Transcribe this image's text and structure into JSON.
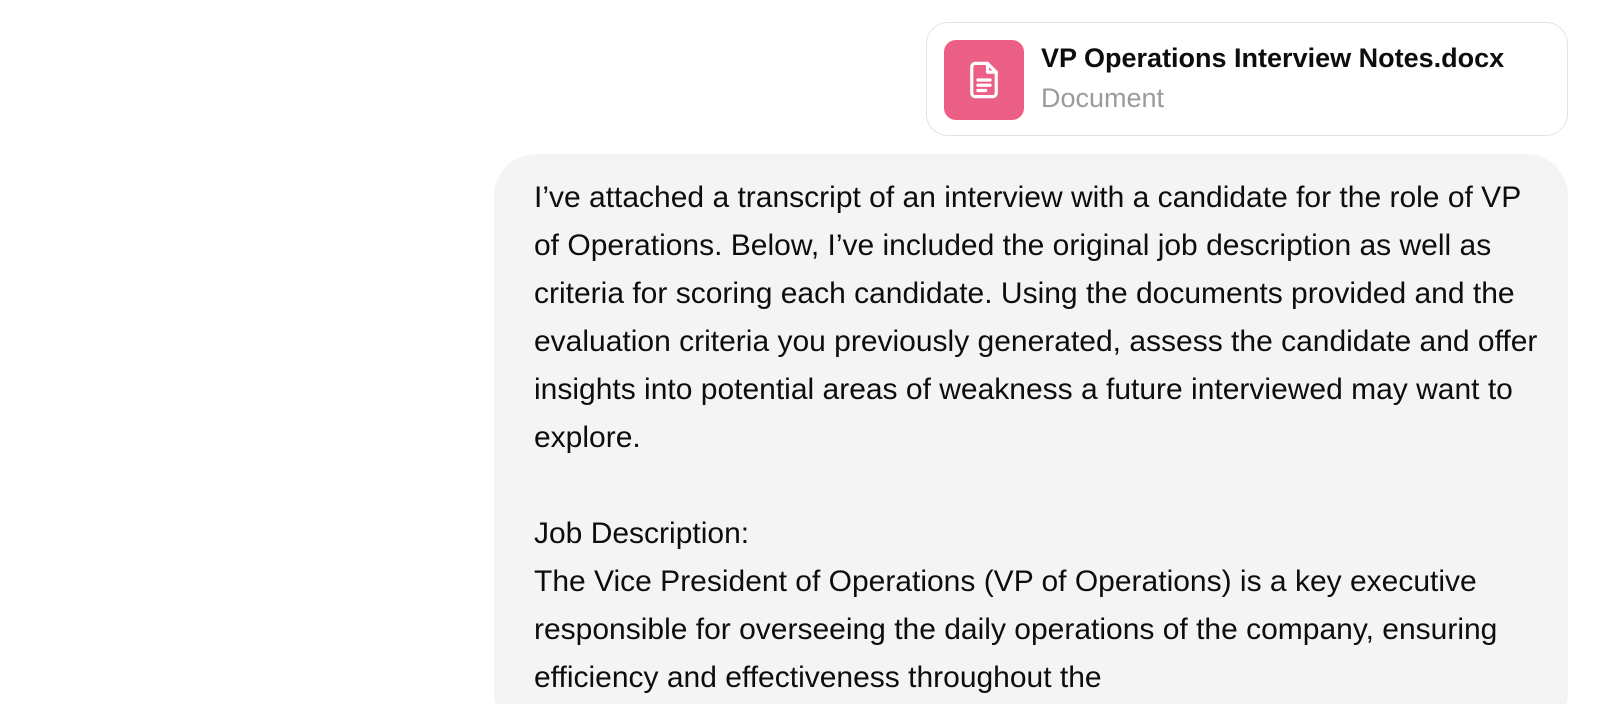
{
  "attachment": {
    "file_name": "VP Operations Interview Notes.docx",
    "file_type": "Document",
    "icon": "document-icon",
    "icon_bg_color": "#ec5f87"
  },
  "message": {
    "intro": "I’ve attached a transcript of an interview with a candidate for the role of VP of Operations. Below, I’ve included the original job description as well as criteria for scoring each candidate. Using the documents provided and the evaluation criteria you previously generated, assess the candidate and offer insights into potential areas of weakness a future interviewed may want to explore.",
    "job_description_heading": "Job Description:",
    "job_description_body": "The Vice President of Operations (VP of Operations) is a key executive responsible for overseeing the daily operations of the company, ensuring efficiency and effectiveness throughout the"
  }
}
